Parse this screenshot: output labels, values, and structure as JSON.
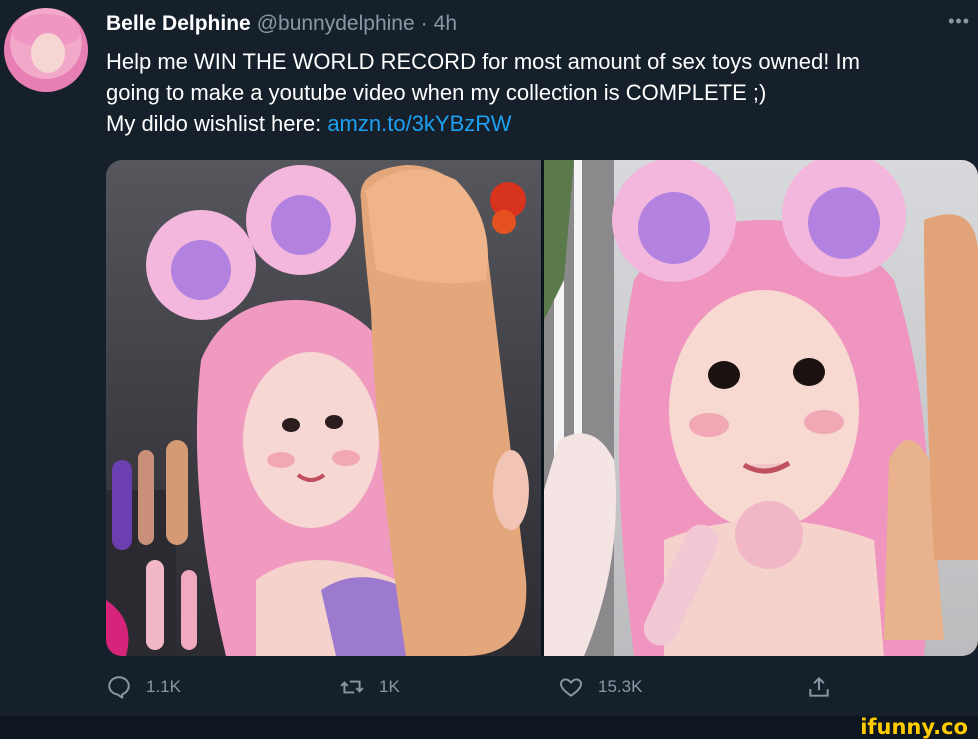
{
  "tweet": {
    "display_name": "Belle Delphine",
    "handle": "@bunnydelphine",
    "separator": "·",
    "time": "4h",
    "more_icon": "more-dots-icon",
    "text_line_1": "Help me WIN THE WORLD RECORD for most amount of sex toys owned! Im",
    "text_line_2": "going to make a youtube video when my collection is COMPLETE ;)",
    "text_line_3_prefix": "My dildo wishlist here: ",
    "link_text": "amzn.to/3kYBzRW"
  },
  "actions": {
    "reply_count": "1.1K",
    "retweet_count": "1K",
    "like_count": "15.3K",
    "reply_icon": "reply-icon",
    "retweet_icon": "retweet-icon",
    "like_icon": "heart-icon",
    "share_icon": "share-icon"
  },
  "colors": {
    "background": "#15202b",
    "link": "#1da1f2",
    "muted": "#8899a6",
    "watermark": "#ffcc00"
  },
  "watermark": "ifunny.co"
}
